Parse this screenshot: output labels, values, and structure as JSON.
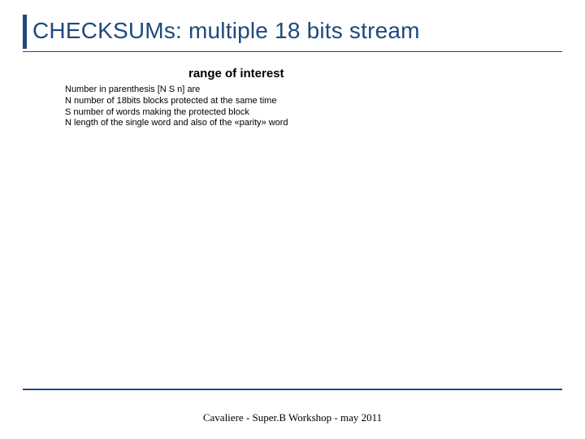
{
  "title": "CHECKSUMs: multiple 18 bits stream",
  "subtitle": "range of interest",
  "body": {
    "line1": "Number in parenthesis [N S n] are",
    "line2": "N number of 18bits blocks protected at the same time",
    "line3": "S number of words making the protected block",
    "line4": "N length of the single word and also of the «parity» word"
  },
  "footer": "Cavaliere - Super.B Workshop - may 2011"
}
